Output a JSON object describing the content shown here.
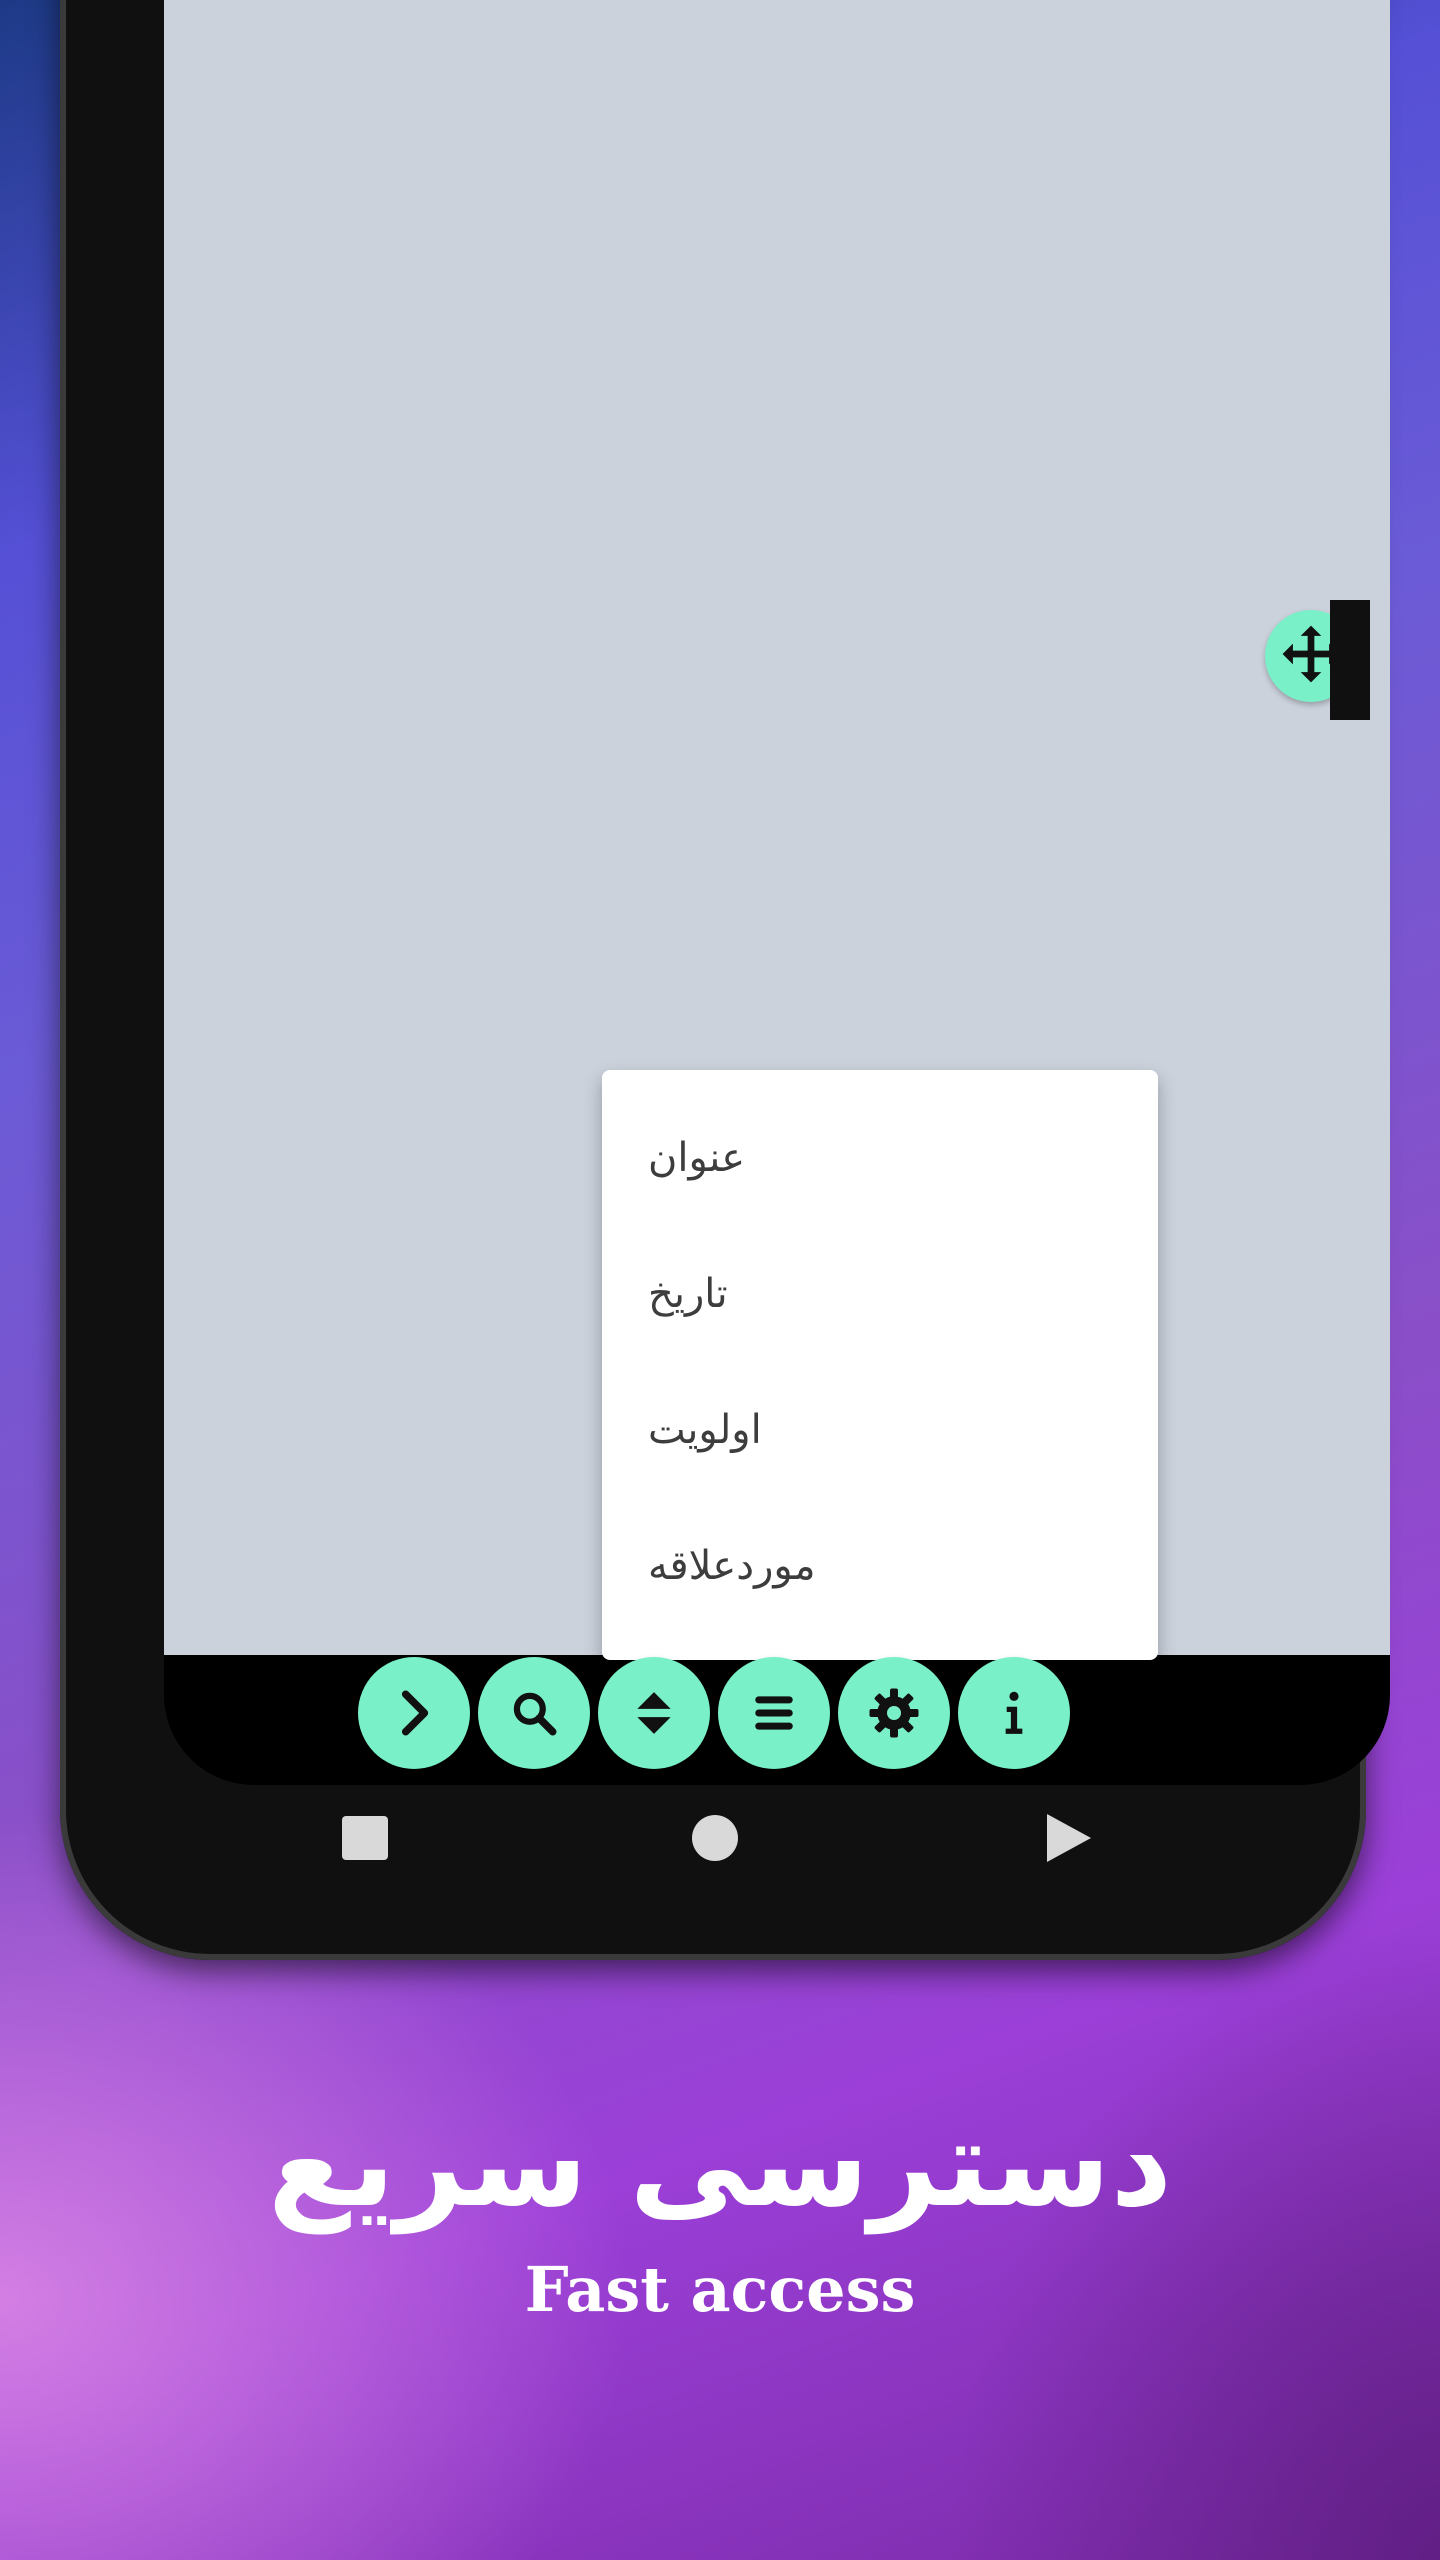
{
  "sort_menu": {
    "items": [
      {
        "label": "عنوان"
      },
      {
        "label": "تاریخ"
      },
      {
        "label": "اولویت"
      },
      {
        "label": "موردعلاقه"
      }
    ]
  },
  "toolbar": {
    "buttons": [
      {
        "icon": "chevron-right-icon"
      },
      {
        "icon": "search-icon"
      },
      {
        "icon": "sort-icon"
      },
      {
        "icon": "menu-icon"
      },
      {
        "icon": "gear-icon"
      },
      {
        "icon": "info-icon"
      }
    ]
  },
  "floating_handle": {
    "icon": "move-icon"
  },
  "navigation": {
    "icons": [
      "recent-apps-icon",
      "home-icon",
      "back-icon"
    ]
  },
  "caption": {
    "title_fa": "دسترسی سریع",
    "subtitle_en": "Fast access"
  },
  "colors": {
    "accent": "#7af0c9",
    "screen_background": "#ccd2dc",
    "menu_background": "#ffffff"
  }
}
